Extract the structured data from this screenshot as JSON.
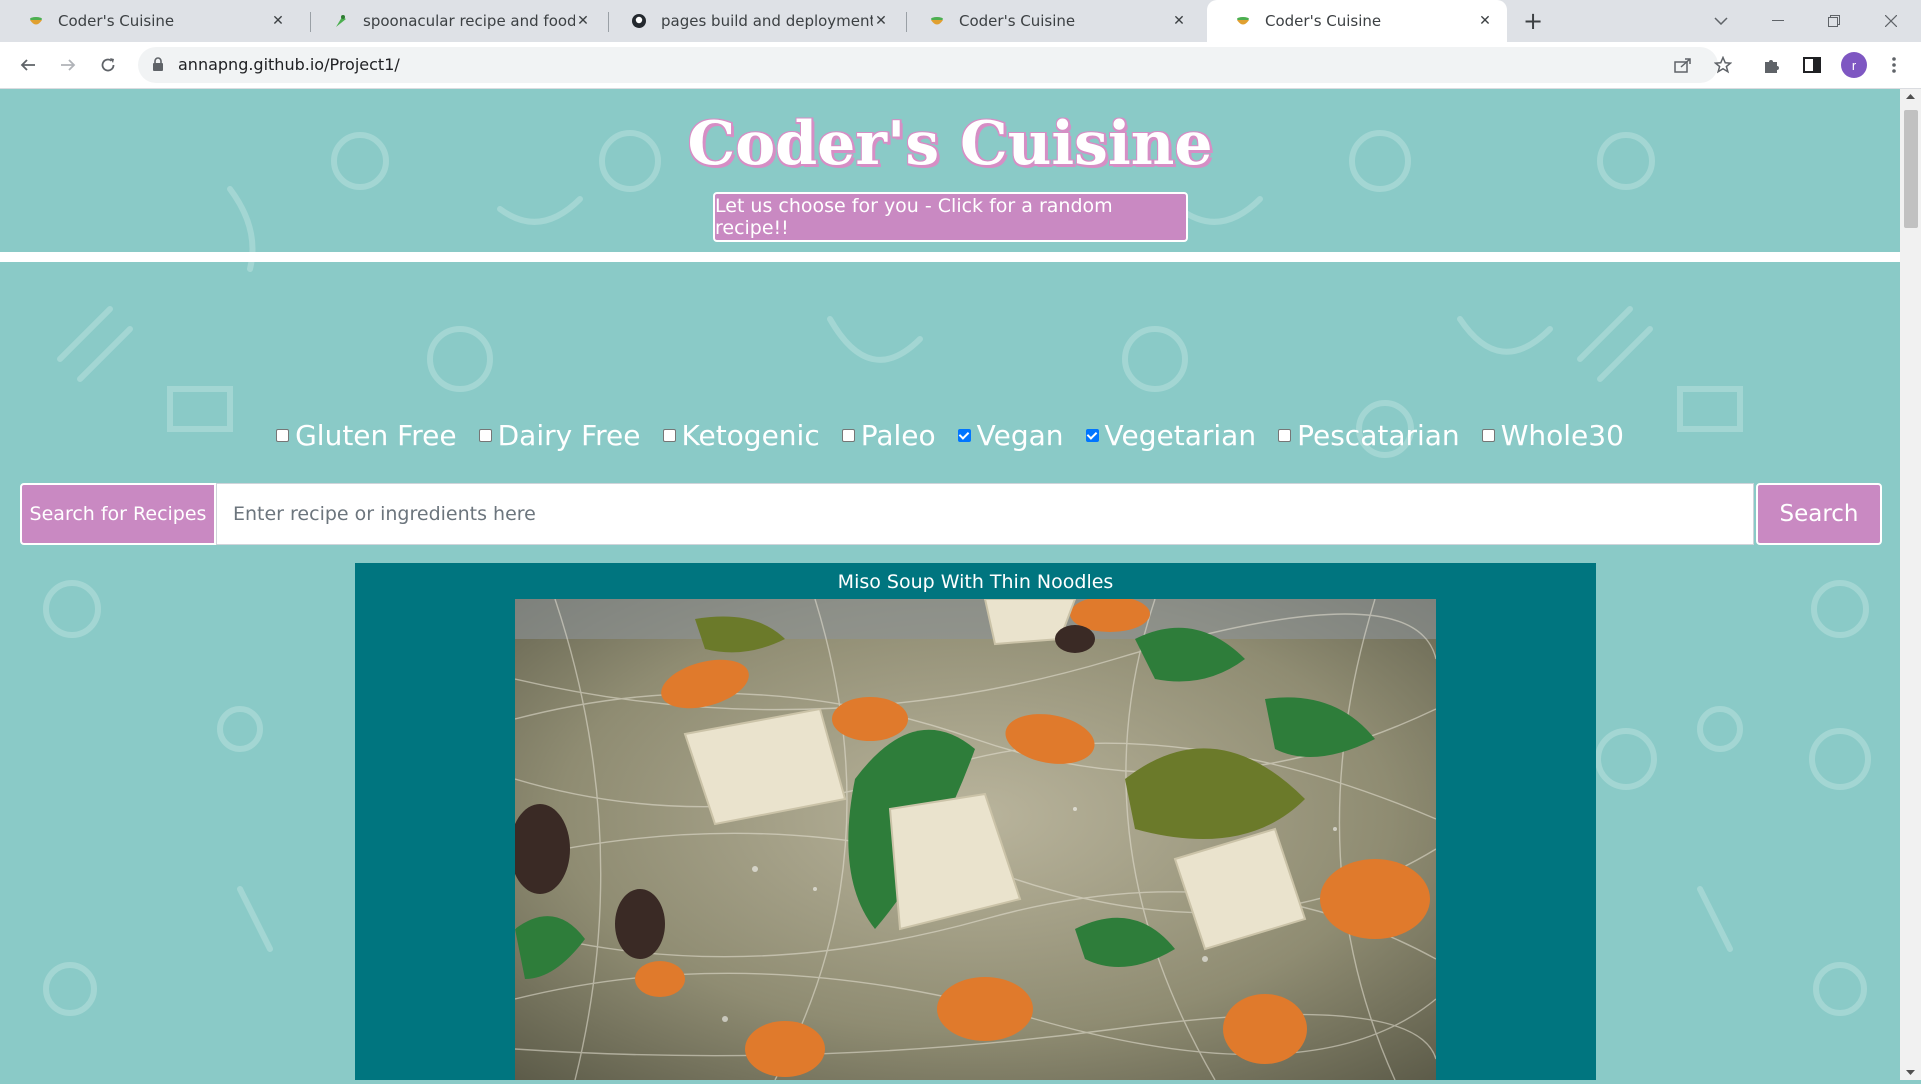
{
  "browser": {
    "tabs": [
      {
        "title": "Coder's Cuisine",
        "icon": "bowl-favicon"
      },
      {
        "title": "spoonacular recipe and food API",
        "icon": "spoonacular-favicon"
      },
      {
        "title": "pages build and deployment · an",
        "icon": "github-favicon"
      },
      {
        "title": "Coder's Cuisine",
        "icon": "bowl-favicon"
      },
      {
        "title": "Coder's Cuisine",
        "icon": "bowl-favicon",
        "active": true
      }
    ],
    "url": "annapng.github.io/Project1/",
    "avatar_initial": "r"
  },
  "site": {
    "title": "Coder's Cuisine",
    "random_button_label": "Let us choose for you - Click for a random recipe!!"
  },
  "diets": [
    {
      "label": "Gluten Free",
      "checked": false
    },
    {
      "label": "Dairy Free",
      "checked": false
    },
    {
      "label": "Ketogenic",
      "checked": false
    },
    {
      "label": "Paleo",
      "checked": false
    },
    {
      "label": "Vegan",
      "checked": true
    },
    {
      "label": "Vegetarian",
      "checked": true
    },
    {
      "label": "Pescatarian",
      "checked": false
    },
    {
      "label": "Whole30",
      "checked": false
    }
  ],
  "search": {
    "label": "Search for Recipes",
    "placeholder": "Enter recipe or ingredients here",
    "button_label": "Search"
  },
  "recipe": {
    "title": "Miso Soup With Thin Noodles"
  },
  "colors": {
    "page_bg": "#8acac7",
    "accent_pink": "#c989c2",
    "card_teal": "#00757f"
  }
}
